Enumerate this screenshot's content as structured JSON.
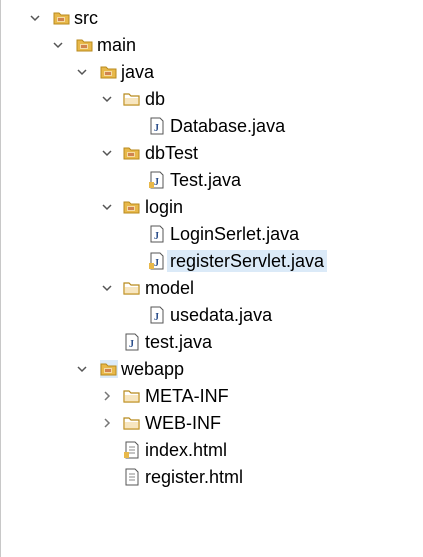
{
  "tree": {
    "items": [
      {
        "label": "src",
        "type": "package-folder",
        "expanded": true,
        "has_twisty": true
      },
      {
        "label": "main",
        "type": "package-folder",
        "expanded": true,
        "has_twisty": true
      },
      {
        "label": "java",
        "type": "package-folder",
        "expanded": true,
        "has_twisty": true
      },
      {
        "label": "db",
        "type": "folder",
        "expanded": true,
        "has_twisty": true
      },
      {
        "label": "Database.java",
        "type": "java-file",
        "has_twisty": false
      },
      {
        "label": "dbTest",
        "type": "folder",
        "expanded": true,
        "has_twisty": true
      },
      {
        "label": "Test.java",
        "type": "java-file-modified",
        "has_twisty": false
      },
      {
        "label": "login",
        "type": "folder",
        "expanded": true,
        "has_twisty": true
      },
      {
        "label": "LoginSerlet.java",
        "type": "java-file",
        "has_twisty": false
      },
      {
        "label": "registerServlet.java",
        "type": "java-file-modified",
        "has_twisty": false,
        "selected": true
      },
      {
        "label": "model",
        "type": "folder",
        "expanded": true,
        "has_twisty": true
      },
      {
        "label": "usedata.java",
        "type": "java-file",
        "has_twisty": false
      },
      {
        "label": "test.java",
        "type": "java-file",
        "has_twisty": false
      },
      {
        "label": "webapp",
        "type": "package-folder",
        "expanded": true,
        "has_twisty": true,
        "highlighted": true
      },
      {
        "label": "META-INF",
        "type": "folder",
        "expanded": false,
        "has_twisty": true
      },
      {
        "label": "WEB-INF",
        "type": "folder",
        "expanded": false,
        "has_twisty": true
      },
      {
        "label": "index.html",
        "type": "html-file-modified",
        "has_twisty": false
      },
      {
        "label": "register.html",
        "type": "html-file",
        "has_twisty": false
      }
    ]
  },
  "colors": {
    "folder": "#e8b84a",
    "folder_dark": "#b88a1c",
    "package_overlay": "#c05c2c",
    "selection": "#dbeaf8",
    "twisty": "#555555"
  }
}
